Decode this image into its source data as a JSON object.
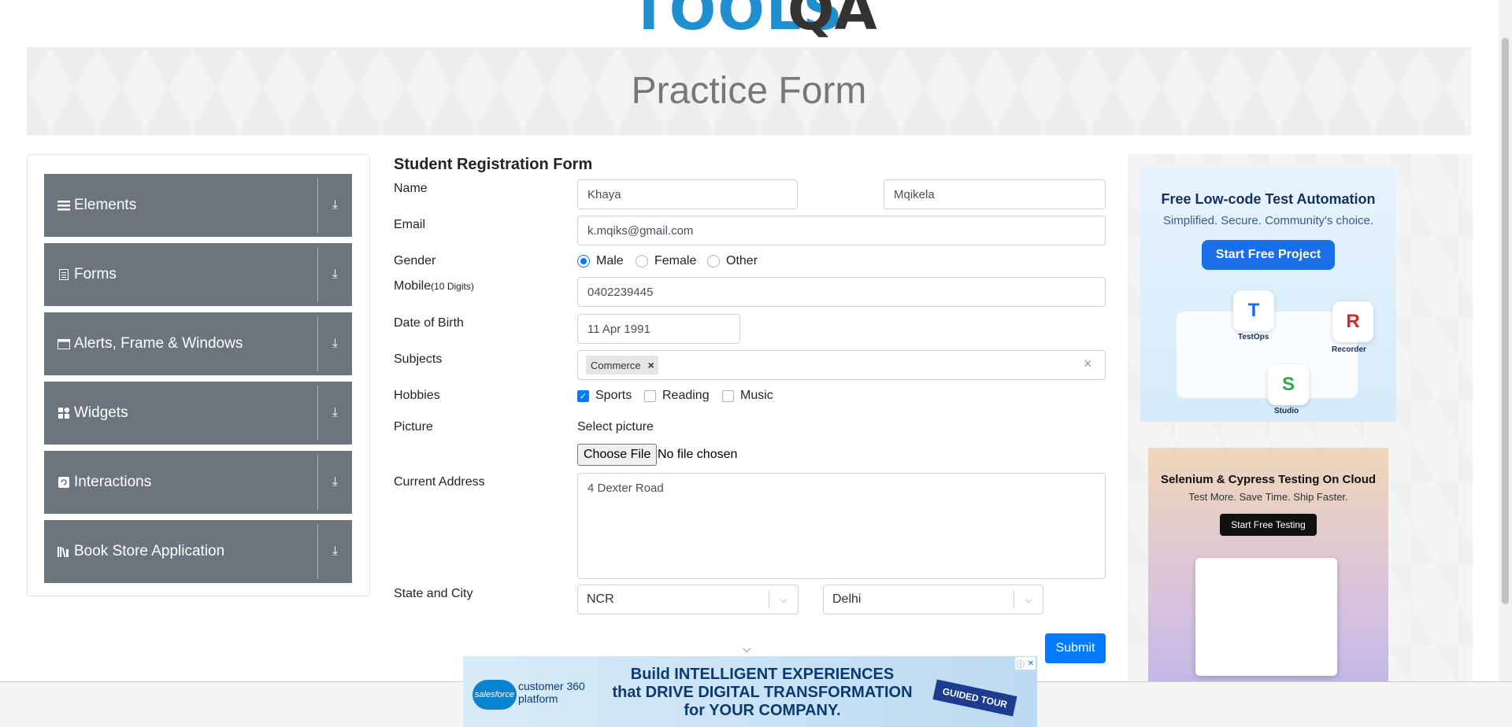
{
  "logo": {
    "text": "TOOLS",
    "qa": "QA"
  },
  "banner": {
    "title": "Practice Form"
  },
  "sidebar": {
    "groups": [
      {
        "label": "Elements",
        "icon": "menu-icon"
      },
      {
        "label": "Forms",
        "icon": "document-icon"
      },
      {
        "label": "Alerts, Frame & Windows",
        "icon": "window-icon"
      },
      {
        "label": "Widgets",
        "icon": "widgets-icon"
      },
      {
        "label": "Interactions",
        "icon": "interactions-icon"
      },
      {
        "label": "Book Store Application",
        "icon": "books-icon"
      }
    ]
  },
  "form": {
    "title": "Student Registration Form",
    "labels": {
      "name": "Name",
      "email": "Email",
      "gender": "Gender",
      "mobile": "Mobile",
      "mobile_hint": "(10 Digits)",
      "dob": "Date of Birth",
      "subjects": "Subjects",
      "hobbies": "Hobbies",
      "picture": "Picture",
      "address": "Current Address",
      "state_city": "State and City"
    },
    "first_name": "Khaya",
    "last_name": "Mqikela",
    "email": "k.mqiks@gmail.com",
    "gender_options": [
      "Male",
      "Female",
      "Other"
    ],
    "gender_selected": "Male",
    "mobile": "0402239445",
    "dob": "11 Apr 1991",
    "subject_chip": "Commerce",
    "chip_remove": "×",
    "clear_all": "×",
    "hobbies": [
      {
        "label": "Sports",
        "checked": true
      },
      {
        "label": "Reading",
        "checked": false
      },
      {
        "label": "Music",
        "checked": false
      }
    ],
    "select_picture": "Select picture",
    "choose_file": "Choose File",
    "no_file": "No file chosen",
    "address": "4 Dexter Road",
    "state": "NCR",
    "city": "Delhi",
    "submit": "Submit"
  },
  "ads": {
    "ad1": {
      "title": "Free Low-code Test Automation",
      "subtitle": "Simplified. Secure. Community's choice.",
      "button": "Start Free Project",
      "testops": "TestOps",
      "recorder": "Recorder",
      "studio": "Studio"
    },
    "ad2": {
      "title": "Selenium & Cypress Testing On Cloud",
      "subtitle": "Test More. Save Time. Ship Faster.",
      "button": "Start Free Testing"
    },
    "bottom": {
      "brand": "salesforce",
      "platform": "customer 360 platform",
      "line1": "Build INTELLIGENT EXPERIENCES",
      "line2": "that DRIVE DIGITAL TRANSFORMATION",
      "line3": "for YOUR COMPANY.",
      "badge": "GUIDED TOUR"
    }
  },
  "colors": {
    "sidebar_group": "#6c757d",
    "primary": "#007bff",
    "logo_blue": "#1f8fcf"
  }
}
